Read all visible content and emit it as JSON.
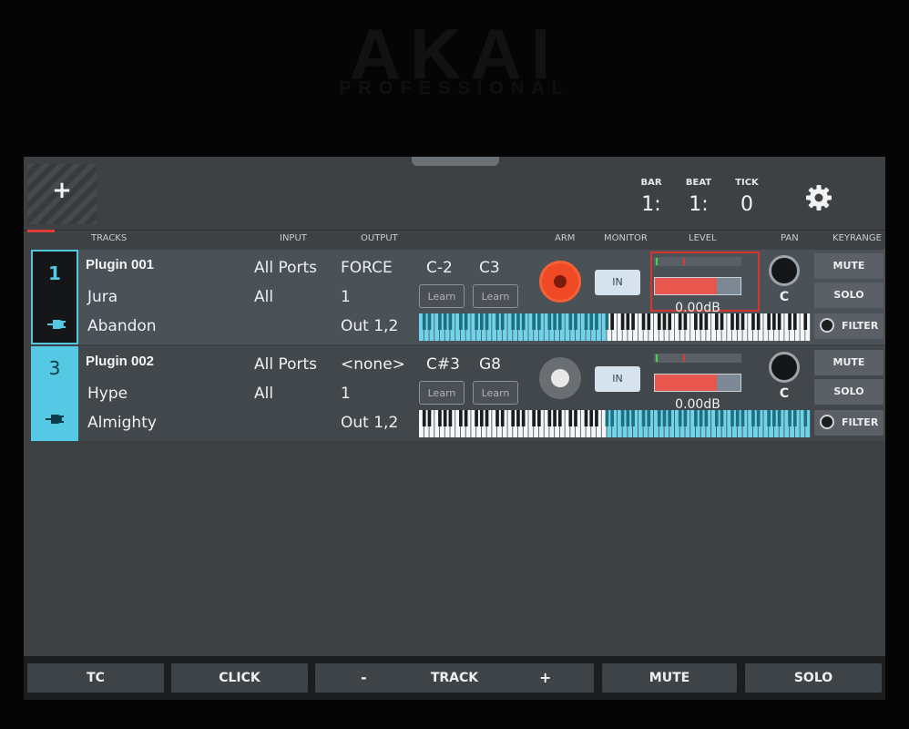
{
  "brand": {
    "logo": "AKAI",
    "sub": "PROFESSIONAL"
  },
  "header": {
    "add_icon": "plus-icon",
    "bar_label": "BAR",
    "bar_value": "1:",
    "beat_label": "BEAT",
    "beat_value": "1:",
    "tick_label": "TICK",
    "tick_value": "0",
    "settings_icon": "gear-icon"
  },
  "columns": {
    "tracks": "TRACKS",
    "input": "INPUT",
    "output": "OUTPUT",
    "arm": "ARM",
    "monitor": "MONITOR",
    "level": "LEVEL",
    "pan": "PAN",
    "keyrange": "KEYRANGE"
  },
  "tracks": [
    {
      "number": "1",
      "name": "Plugin 001",
      "plugin": "Jura",
      "preset": "Abandon",
      "input_port": "All Ports",
      "input_channel": "All",
      "output_device": "FORCE",
      "output_channel": "1",
      "output_audio": "Out 1,2",
      "key_low": "C-2",
      "key_high": "C3",
      "learn_low": "Learn",
      "learn_high": "Learn",
      "armed": true,
      "monitor": "IN",
      "level": "0.00dB",
      "fader_fraction": 0.72,
      "pan": "C",
      "mute": "MUTE",
      "solo": "SOLO",
      "filter": "FILTER",
      "keyrange_highlight": [
        0,
        0.48
      ],
      "selected": true
    },
    {
      "number": "3",
      "name": "Plugin 002",
      "plugin": "Hype",
      "preset": "Almighty",
      "input_port": "All Ports",
      "input_channel": "All",
      "output_device": "<none>",
      "output_channel": "1",
      "output_audio": "Out 1,2",
      "key_low": "C#3",
      "key_high": "G8",
      "learn_low": "Learn",
      "learn_high": "Learn",
      "armed": false,
      "monitor": "IN",
      "level": "0.00dB",
      "fader_fraction": 0.72,
      "pan": "C",
      "mute": "MUTE",
      "solo": "SOLO",
      "filter": "FILTER",
      "keyrange_highlight": [
        0.48,
        1
      ],
      "selected": false
    }
  ],
  "bottom": {
    "tc": "TC",
    "click": "CLICK",
    "track_minus": "-",
    "track": "TRACK",
    "track_plus": "+",
    "mute": "MUTE",
    "solo": "SOLO"
  },
  "colors": {
    "accent": "#55c9e3",
    "arm": "#ef4a25",
    "meter": "#e9564d",
    "select": "#d8342e"
  }
}
